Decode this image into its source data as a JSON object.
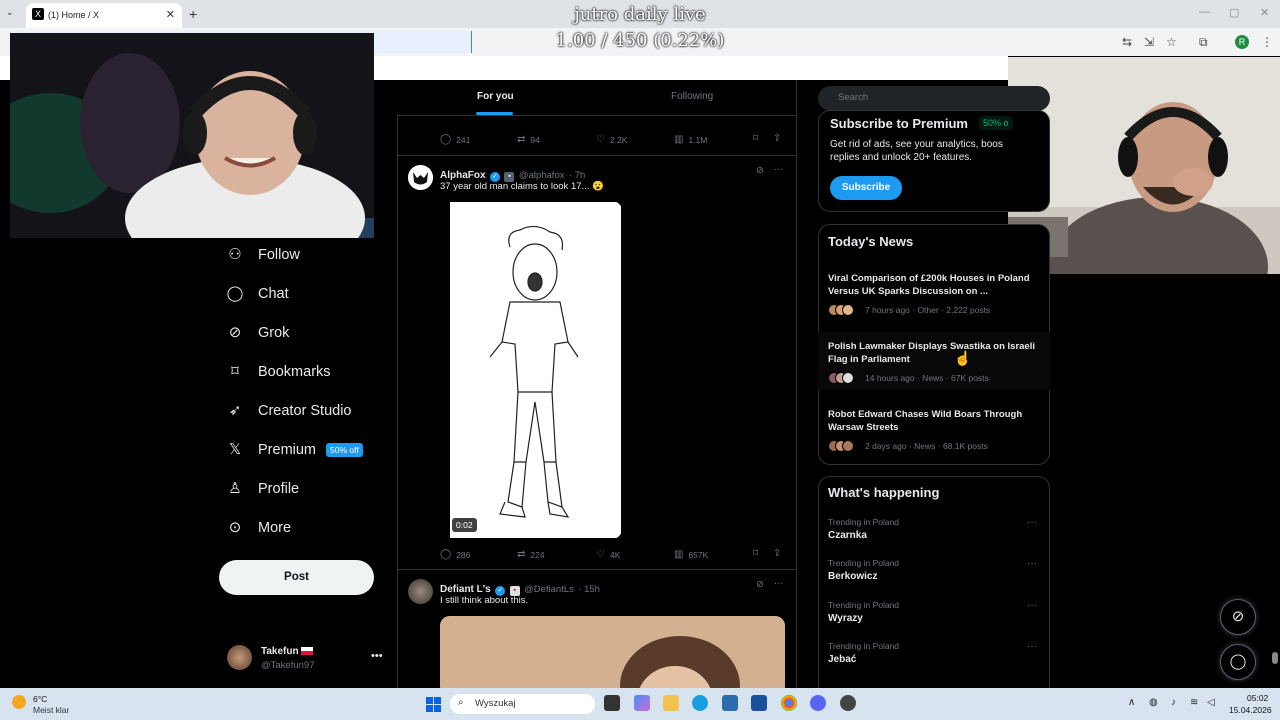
{
  "browser": {
    "tab_title": "(1) Home / X",
    "tab_favicon": "X",
    "new_tab": "+",
    "profile_initial": "R"
  },
  "overlay": {
    "title": "jutro daily live",
    "progress_text": "1.00 / 450 (0.22%)",
    "progress_fraction": 0.0022
  },
  "sidebar": {
    "items": [
      {
        "label": "Follow",
        "icon": "follow-icon"
      },
      {
        "label": "Chat",
        "icon": "chat-icon"
      },
      {
        "label": "Grok",
        "icon": "grok-icon"
      },
      {
        "label": "Bookmarks",
        "icon": "bookmark-icon"
      },
      {
        "label": "Creator Studio",
        "icon": "rocket-icon"
      },
      {
        "label": "Premium",
        "icon": "x-logo-icon",
        "badge": "50% off"
      },
      {
        "label": "Profile",
        "icon": "person-icon"
      },
      {
        "label": "More",
        "icon": "more-circle-icon"
      }
    ],
    "post_label": "Post",
    "account": {
      "name": "Takefun",
      "handle": "@Takefun97"
    }
  },
  "feed": {
    "tabs": [
      "For you",
      "Following"
    ],
    "prev_metrics": {
      "replies": "241",
      "reposts": "94",
      "likes": "2.2K",
      "views": "1.1M"
    },
    "tweets": [
      {
        "name": "AlphaFox",
        "handle": "@alphafox",
        "time": "· 7h",
        "text": "37 year old man claims to look 17... 😮",
        "duration": "0:02",
        "metrics": {
          "replies": "286",
          "reposts": "224",
          "likes": "4K",
          "views": "657K"
        }
      },
      {
        "name": "Defiant L's",
        "handle": "@DefiantLs",
        "time": "· 15h",
        "text": "I still think about this."
      }
    ]
  },
  "right": {
    "search_placeholder": "Search",
    "premium": {
      "title": "Subscribe to Premium",
      "badge": "50% o",
      "desc": "Get rid of ads, see your analytics, boos replies and unlock 20+ features.",
      "button": "Subscribe"
    },
    "news": {
      "title": "Today's News",
      "items": [
        {
          "headline": "Viral Comparison of £200k Houses in Poland Versus UK Sparks Discussion on ...",
          "meta": "7 hours ago · Other · 2,222 posts"
        },
        {
          "headline": "Polish Lawmaker Displays Swastika on Israeli Flag in Parliament",
          "meta": "14 hours ago · News · 67K posts"
        },
        {
          "headline": "Robot Edward Chases Wild Boars Through Warsaw Streets",
          "meta": "2 days ago · News · 68.1K posts"
        }
      ]
    },
    "happening": {
      "title": "What's happening",
      "items": [
        {
          "label": "Trending in Poland",
          "name": "Czarnka"
        },
        {
          "label": "Trending in Poland",
          "name": "Berkowicz"
        },
        {
          "label": "Trending in Poland",
          "name": "Wyrazy"
        },
        {
          "label": "Trending in Poland",
          "name": "Jebać"
        }
      ]
    }
  },
  "taskbar": {
    "weather_temp": "6°C",
    "weather_desc": "Meist klar",
    "search_placeholder": "Wyszukaj",
    "time": "05:02",
    "date": "15.04.2026"
  },
  "colors": {
    "accent": "#1d9bf0",
    "background": "#000000",
    "muted": "#71767b",
    "green": "#00ba7c"
  }
}
